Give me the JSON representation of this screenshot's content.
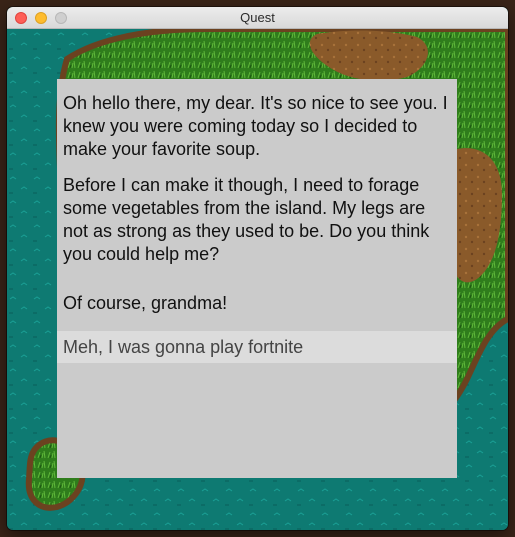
{
  "window": {
    "title": "Quest"
  },
  "dialog": {
    "paragraphs": [
      "Oh hello there, my dear. It's so nice to see you. I knew you were coming today so I decided to make your favorite soup.",
      "Before I can make it though, I need to forage some vegetables from the island. My legs are not as strong as they used to be. Do you think you could help me?"
    ],
    "options": [
      {
        "label": "Of course, grandma!",
        "highlighted": false
      },
      {
        "label": "Meh, I was gonna play fortnite",
        "highlighted": true
      }
    ]
  },
  "colors": {
    "water": "#0e7a72",
    "grass": "#2f7d1c",
    "dirt": "#8a5a2a",
    "dialog_bg": "#cbcbcb",
    "option_highlight": "#dcdcdc"
  }
}
